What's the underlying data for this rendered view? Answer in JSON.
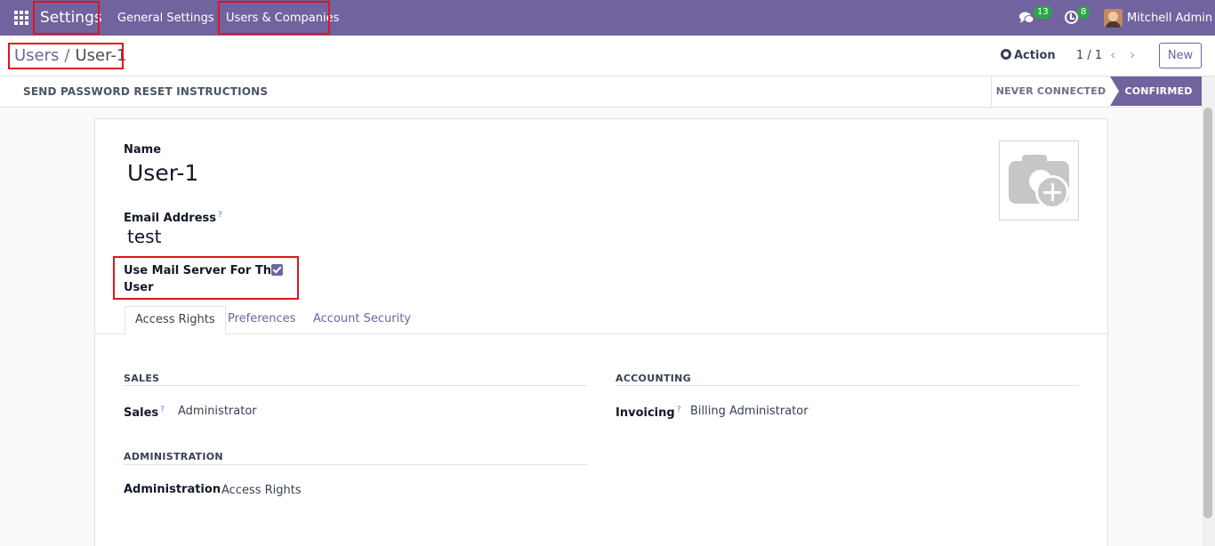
{
  "navbar": {
    "app_name": "Settings",
    "menu": [
      "General Settings",
      "Users & Companies"
    ],
    "messages_count": "13",
    "activities_count": "8",
    "user_name": "Mitchell Admin"
  },
  "control_panel": {
    "breadcrumb_parent": "Users",
    "breadcrumb_current": "User-1",
    "action_label": "Action",
    "pager": "1 / 1",
    "new_label": "New"
  },
  "statusbar": {
    "reset_label": "SEND PASSWORD RESET INSTRUCTIONS",
    "stages": [
      "NEVER CONNECTED",
      "CONFIRMED"
    ],
    "active_stage": "CONFIRMED"
  },
  "form": {
    "name_label": "Name",
    "name_value": "User-1",
    "email_label": "Email Address",
    "email_value": "test",
    "mail_server_label_line1": "Use Mail Server For This",
    "mail_server_label_line2": "User",
    "mail_server_checked": true,
    "help_mark": "?"
  },
  "tabs": [
    "Access Rights",
    "Preferences",
    "Account Security"
  ],
  "access_rights": {
    "sales_section": "SALES",
    "sales_label": "Sales",
    "sales_value": "Administrator",
    "accounting_section": "ACCOUNTING",
    "invoicing_label": "Invoicing",
    "invoicing_value": "Billing Administrator",
    "administration_section": "ADMINISTRATION",
    "administration_label": "Administration",
    "administration_value": "Access Rights"
  },
  "colors": {
    "brand": "#71639e",
    "badge": "#28a745",
    "highlight": "#e0141e"
  }
}
